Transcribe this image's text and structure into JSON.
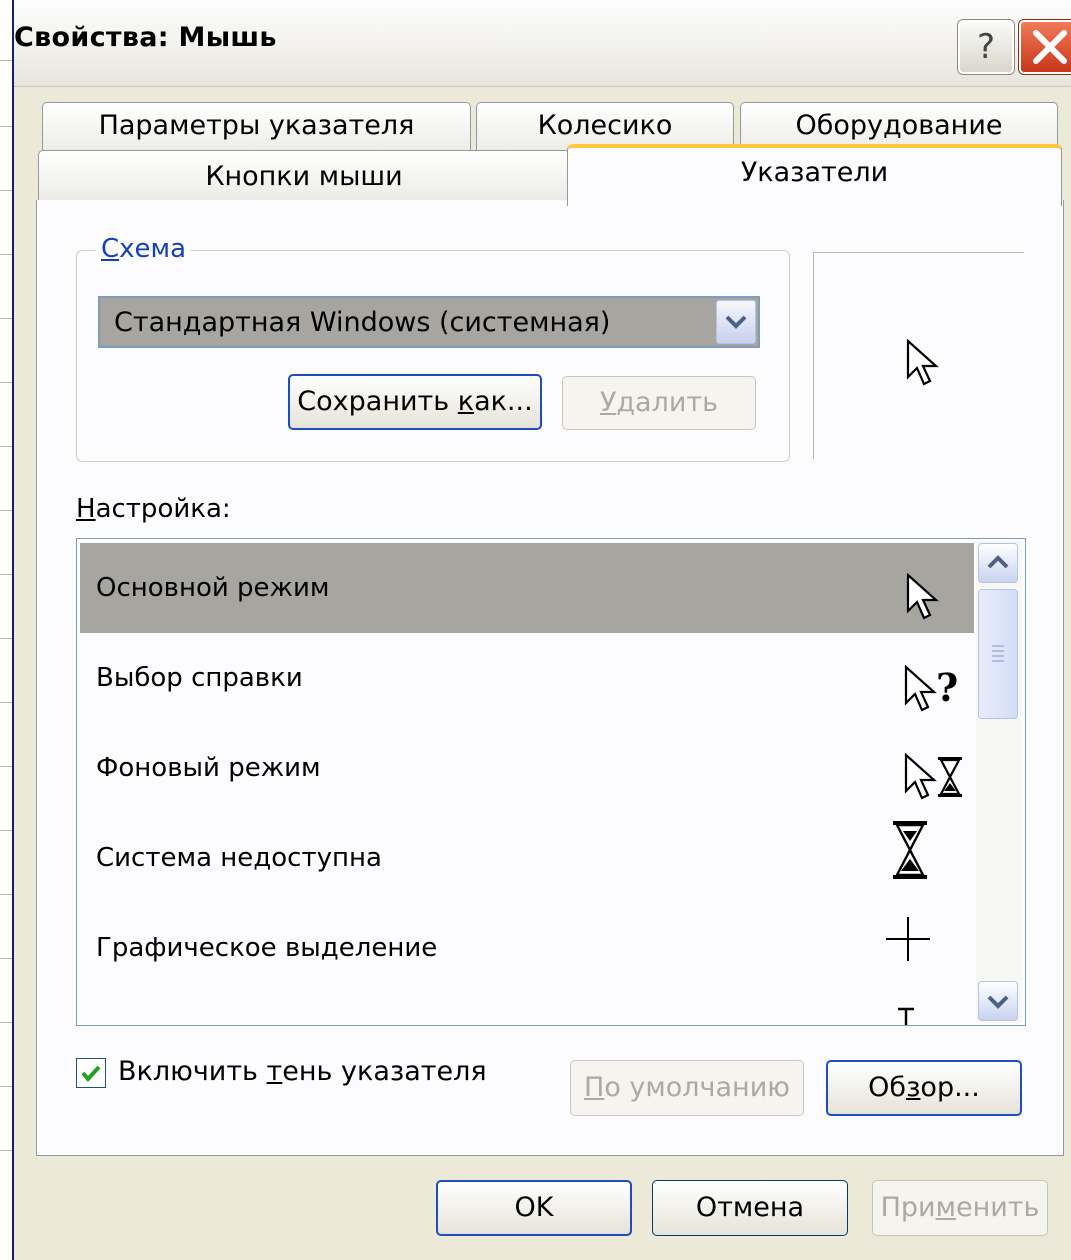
{
  "window": {
    "title": "Свойства: Мышь",
    "help_label": "?"
  },
  "tabs": {
    "row1": [
      "Параметры указателя",
      "Колесико",
      "Оборудование"
    ],
    "row2": [
      "Кнопки мыши",
      "Указатели"
    ],
    "active": "Указатели"
  },
  "scheme": {
    "legend_first": "С",
    "legend_rest": "хема",
    "selected": "Стандартная Windows (системная)",
    "save_as_pre": "Сохранить ",
    "save_as_u": "к",
    "save_as_post": "ак...",
    "delete_u": "У",
    "delete_rest": "далить"
  },
  "customize": {
    "label_u": "Н",
    "label_rest": "астройка:",
    "items": [
      {
        "label": "Основной режим",
        "icon": "arrow-cursor",
        "selected": true
      },
      {
        "label": "Выбор справки",
        "icon": "help-select-cursor",
        "selected": false
      },
      {
        "label": "Фоновый режим",
        "icon": "working-in-background-cursor",
        "selected": false
      },
      {
        "label": "Система недоступна",
        "icon": "busy-hourglass-cursor",
        "selected": false
      },
      {
        "label": "Графическое выделение",
        "icon": "precision-select-cursor",
        "selected": false
      },
      {
        "label": "",
        "icon": "text-select-cursor",
        "selected": false
      }
    ]
  },
  "options": {
    "shadow_checked": true,
    "shadow_pre": "Включить ",
    "shadow_u": "т",
    "shadow_post": "ень указателя",
    "default_u": "П",
    "default_rest": "о умолчанию",
    "browse_pre": "Об",
    "browse_u": "з",
    "browse_post": "ор..."
  },
  "buttons": {
    "ok": "OK",
    "cancel": "Отмена",
    "apply_pre": "При",
    "apply_u": "м",
    "apply_post": "енить"
  },
  "colors": {
    "title_bar_close": "#d6431f",
    "active_tab_accent": "#ffc83c",
    "selection": "#a6a5a0",
    "check": "#21a121"
  }
}
